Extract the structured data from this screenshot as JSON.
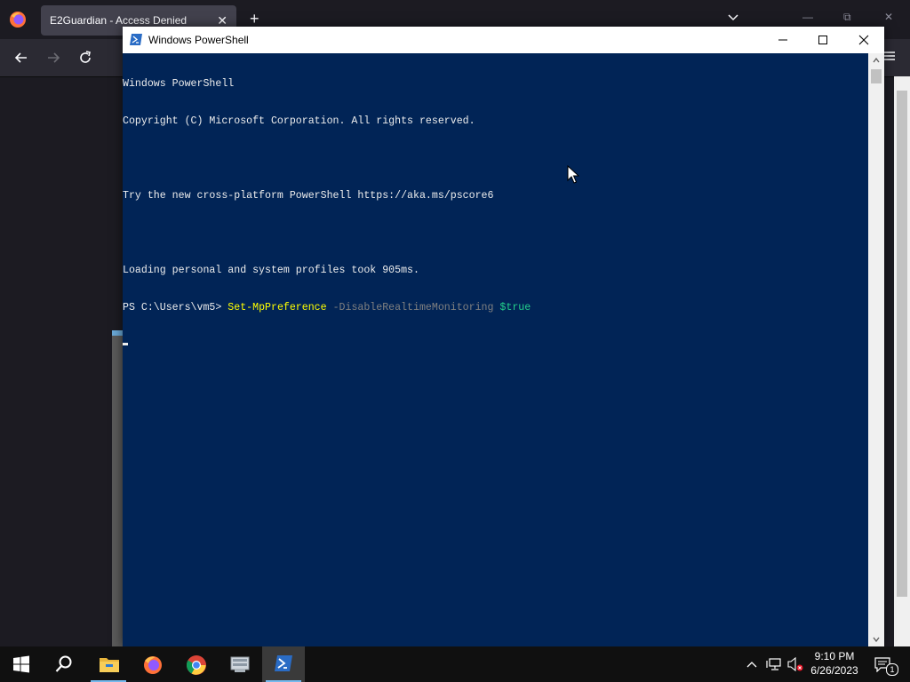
{
  "firefox": {
    "tab_title": "E2Guardian - Access Denied",
    "tab_close": "✕",
    "new_tab": "+",
    "win_minimize": "—",
    "win_restore": "⧉",
    "win_close": "✕"
  },
  "powershell": {
    "window_title": "Windows PowerShell",
    "console_lines": [
      "Windows PowerShell",
      "Copyright (C) Microsoft Corporation. All rights reserved.",
      "",
      "Try the new cross-platform PowerShell https://aka.ms/pscore6",
      "",
      "Loading personal and system profiles took 905ms."
    ],
    "prompt": "PS C:\\Users\\vm5> ",
    "command": "Set-MpPreference",
    "parameter": " -DisableRealtimeMonitoring ",
    "argument": "$true",
    "colors": {
      "background": "#012456",
      "text": "#ededed",
      "command": "#ffff00",
      "parameter": "#808080",
      "argument": "#23d18b"
    }
  },
  "taskbar": {
    "apps": [
      {
        "icon": "windows-start-icon"
      },
      {
        "icon": "search-icon"
      },
      {
        "icon": "file-explorer-icon"
      },
      {
        "icon": "firefox-icon"
      },
      {
        "icon": "chrome-icon"
      },
      {
        "icon": "server-manager-icon"
      },
      {
        "icon": "powershell-icon"
      }
    ],
    "clock_time": "9:10 PM",
    "clock_date": "6/26/2023",
    "notification_count": "1"
  }
}
